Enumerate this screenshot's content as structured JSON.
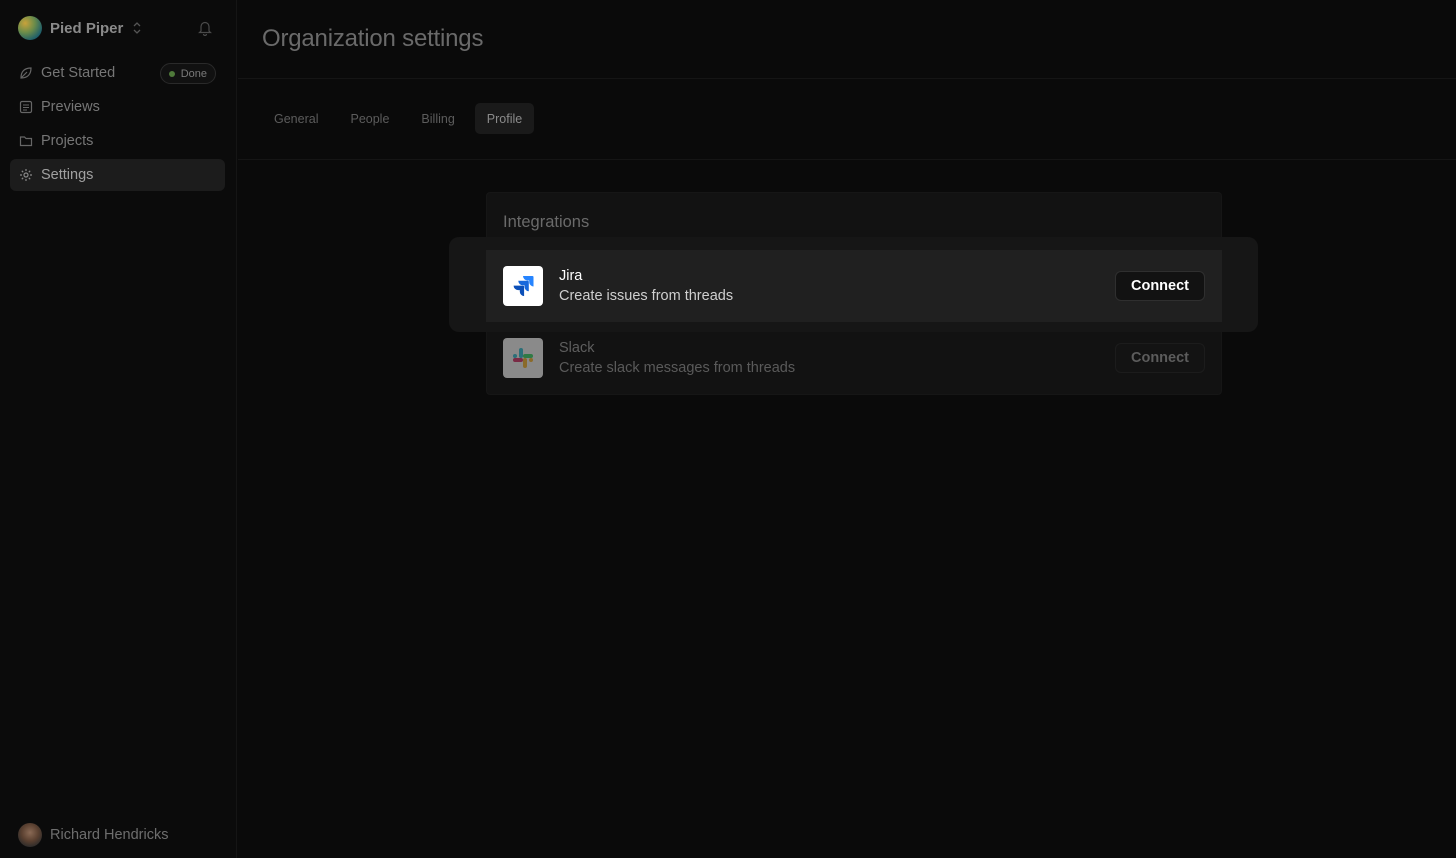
{
  "sidebar": {
    "org_name": "Pied Piper",
    "items": [
      {
        "label": "Get Started",
        "icon": "leaf-icon",
        "badge": "Done"
      },
      {
        "label": "Previews",
        "icon": "preview-icon"
      },
      {
        "label": "Projects",
        "icon": "folder-icon"
      },
      {
        "label": "Settings",
        "icon": "gear-icon",
        "active": true
      }
    ],
    "user_name": "Richard Hendricks"
  },
  "page": {
    "title": "Organization settings",
    "tabs": [
      {
        "label": "General"
      },
      {
        "label": "People"
      },
      {
        "label": "Billing"
      },
      {
        "label": "Profile",
        "active": true
      }
    ]
  },
  "integrations": {
    "title": "Integrations",
    "items": [
      {
        "name": "Jira",
        "description": "Create issues from threads",
        "button": "Connect",
        "icon": "jira-logo"
      },
      {
        "name": "Slack",
        "description": "Create slack messages from threads",
        "button": "Connect",
        "icon": "slack-logo"
      }
    ]
  },
  "colors": {
    "background": "#0a0a0a",
    "highlight_row": "#202020",
    "jira_blue": "#2684FF",
    "badge_dot": "#4f7a3a"
  }
}
